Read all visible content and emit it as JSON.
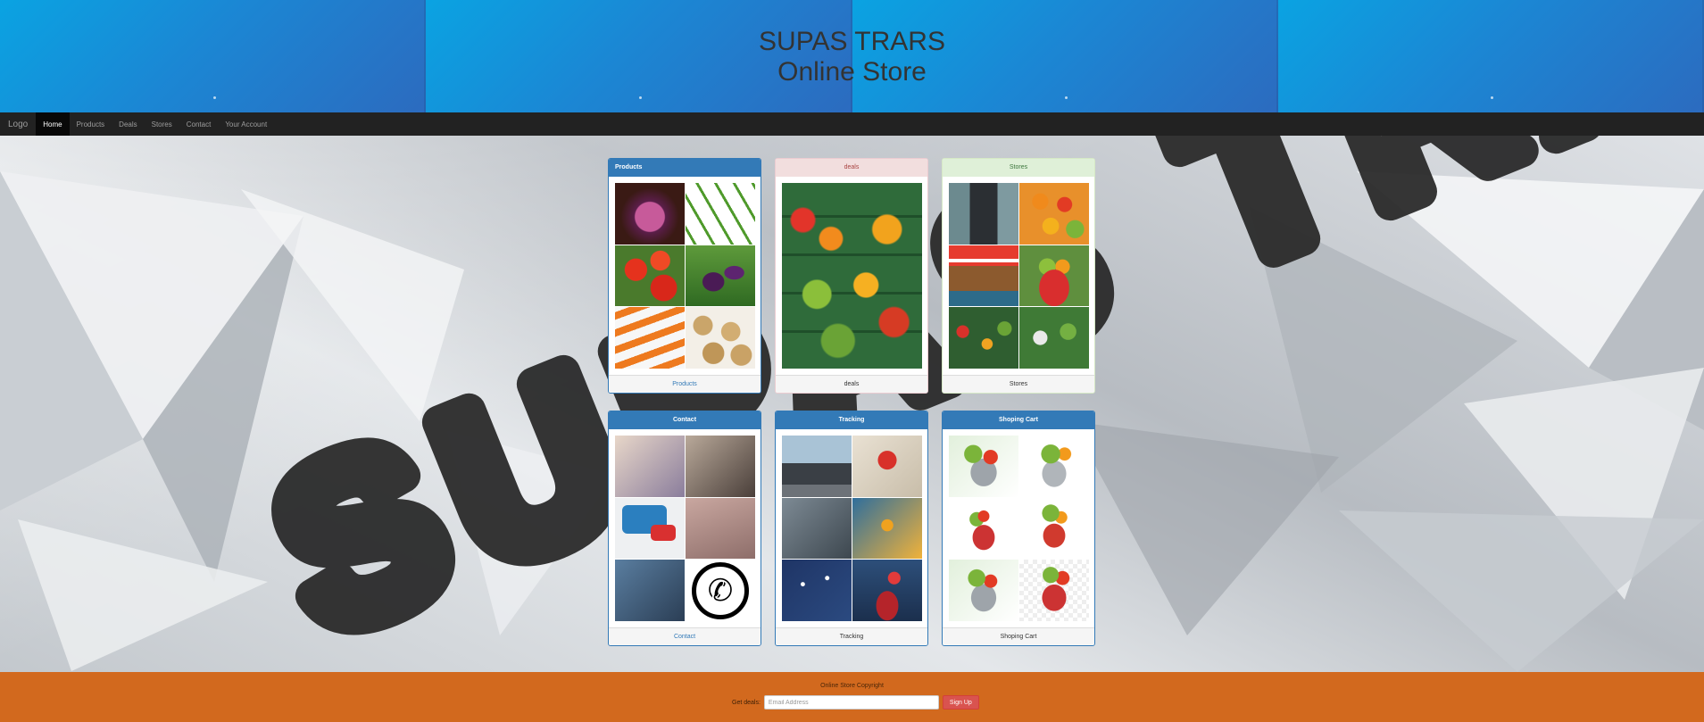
{
  "banner": {
    "title_line1": "SUPAS TRARS",
    "title_line2": "Online Store"
  },
  "navbar": {
    "brand": "Logo",
    "items": [
      {
        "label": "Home",
        "active": true
      },
      {
        "label": "Products",
        "active": false
      },
      {
        "label": "Deals",
        "active": false
      },
      {
        "label": "Stores",
        "active": false
      },
      {
        "label": "Contact",
        "active": false
      },
      {
        "label": "Your Account",
        "active": false
      }
    ]
  },
  "background": {
    "watermark_text": "SUPAS TRARES"
  },
  "panels": {
    "products": {
      "heading": "Products",
      "footer": "Products",
      "style": "primary"
    },
    "deals": {
      "heading": "deals",
      "footer": "deals",
      "style": "danger"
    },
    "stores": {
      "heading": "Stores",
      "footer": "Stores",
      "style": "success"
    },
    "contact": {
      "heading": "Contact",
      "footer": "Contact",
      "style": "primary"
    },
    "tracking": {
      "heading": "Tracking",
      "footer": "Tracking",
      "style": "primary"
    },
    "cart": {
      "heading": "Shoping Cart",
      "footer": "Shoping Cart",
      "style": "primary"
    }
  },
  "footer": {
    "copyright": "Online Store Copyright",
    "subscribe_label": "Get deals:",
    "email_placeholder": "Email Address",
    "signup_label": "Sign Up"
  },
  "colors": {
    "banner": "#1b87d4",
    "navbar": "#222222",
    "footer": "#d2691e",
    "panel_primary": "#337ab7",
    "signup_button": "#d9534f"
  }
}
